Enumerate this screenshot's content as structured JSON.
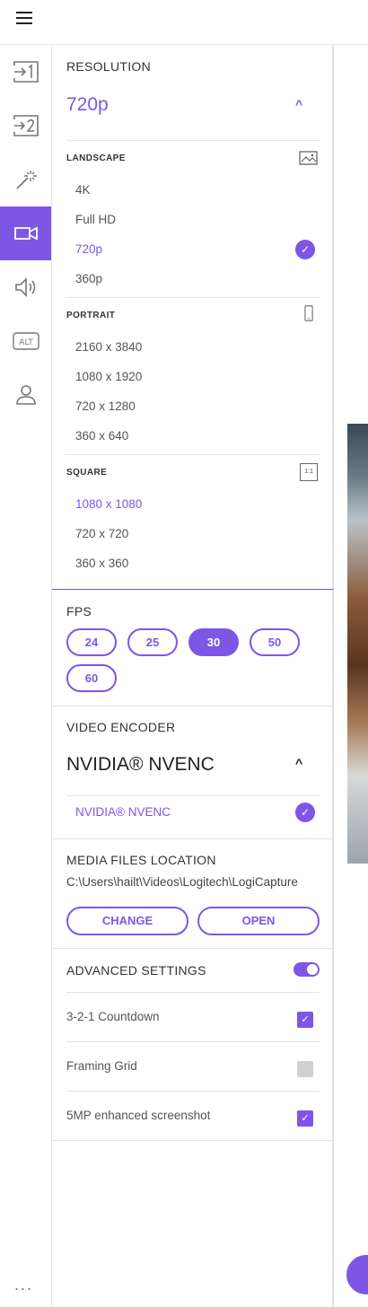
{
  "rail": {
    "more": "..."
  },
  "resolution": {
    "title": "RESOLUTION",
    "selected": "720p",
    "landscape": {
      "label": "LANDSCAPE",
      "options": [
        "4K",
        "Full HD",
        "720p",
        "360p"
      ]
    },
    "portrait": {
      "label": "PORTRAIT",
      "options": [
        "2160 x 3840",
        "1080 x 1920",
        "720 x 1280",
        "360 x 640"
      ]
    },
    "square": {
      "label": "SQUARE",
      "icon_text": "1:1",
      "options": [
        "1080 x 1080",
        "720 x 720",
        "360 x 360"
      ]
    }
  },
  "fps": {
    "title": "FPS",
    "options": [
      "24",
      "25",
      "30",
      "50",
      "60"
    ],
    "selected": "30"
  },
  "encoder": {
    "title": "VIDEO ENCODER",
    "selected": "NVIDIA® NVENC",
    "options": [
      "NVIDIA® NVENC"
    ]
  },
  "media": {
    "title": "MEDIA FILES LOCATION",
    "path": "C:\\Users\\hailt\\Videos\\Logitech\\LogiCapture",
    "change_label": "CHANGE",
    "open_label": "OPEN"
  },
  "advanced": {
    "title": "ADVANCED SETTINGS",
    "enabled": true,
    "items": [
      {
        "label": "3-2-1 Countdown",
        "checked": true
      },
      {
        "label": "Framing Grid",
        "checked": false
      },
      {
        "label": "5MP enhanced screenshot",
        "checked": true
      }
    ]
  },
  "colors": {
    "accent": "#7e56e6"
  }
}
